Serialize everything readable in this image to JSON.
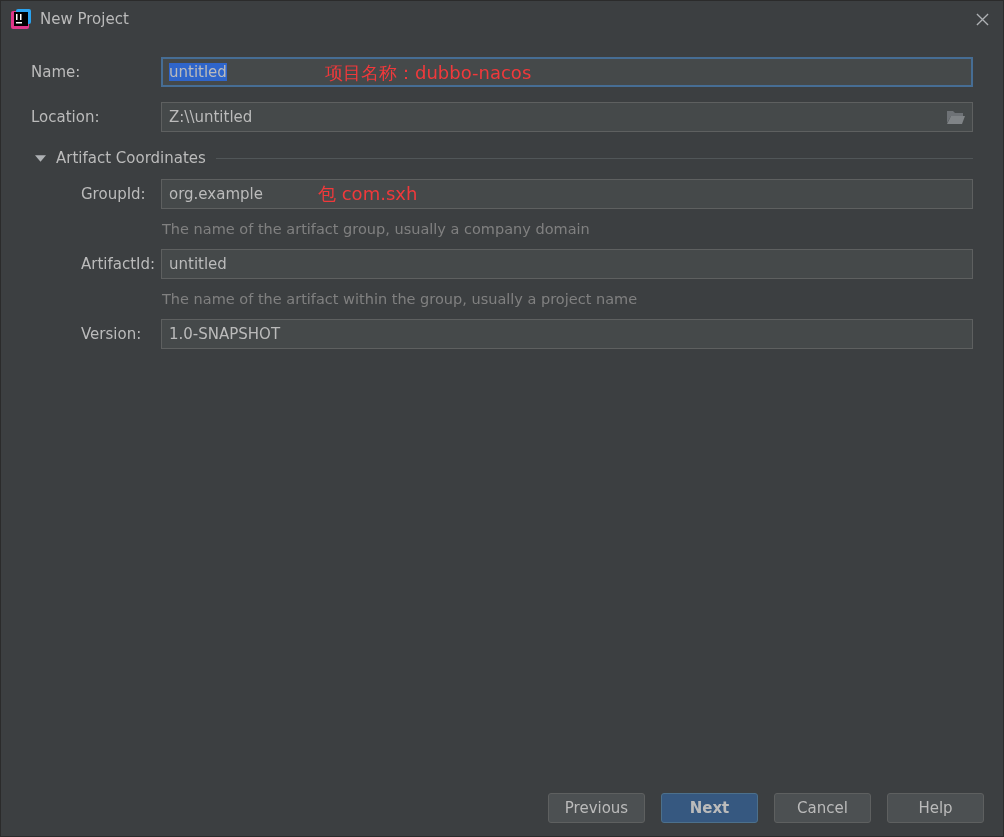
{
  "window": {
    "title": "New Project"
  },
  "fields": [
    {
      "label": "Name:",
      "value": "untitled",
      "kind": "text",
      "focused": true,
      "annotation": "项目名称：dubbo-nacos"
    },
    {
      "label": "Location:",
      "value": "Z:\\\\untitled",
      "kind": "folder",
      "focused": false
    }
  ],
  "section": {
    "title": "Artifact Coordinates",
    "expanded": true,
    "fields": [
      {
        "label": "GroupId:",
        "value": "org.example",
        "annotation": "包 com.sxh",
        "hint": "The name of the artifact group, usually a company domain"
      },
      {
        "label": "ArtifactId:",
        "value": "untitled",
        "hint": "The name of the artifact within the group, usually a project name"
      },
      {
        "label": "Version:",
        "value": "1.0-SNAPSHOT"
      }
    ]
  },
  "buttons": [
    {
      "label": "Previous",
      "default": false
    },
    {
      "label": "Next",
      "default": true
    },
    {
      "label": "Cancel",
      "default": false
    },
    {
      "label": "Help",
      "default": false
    }
  ]
}
